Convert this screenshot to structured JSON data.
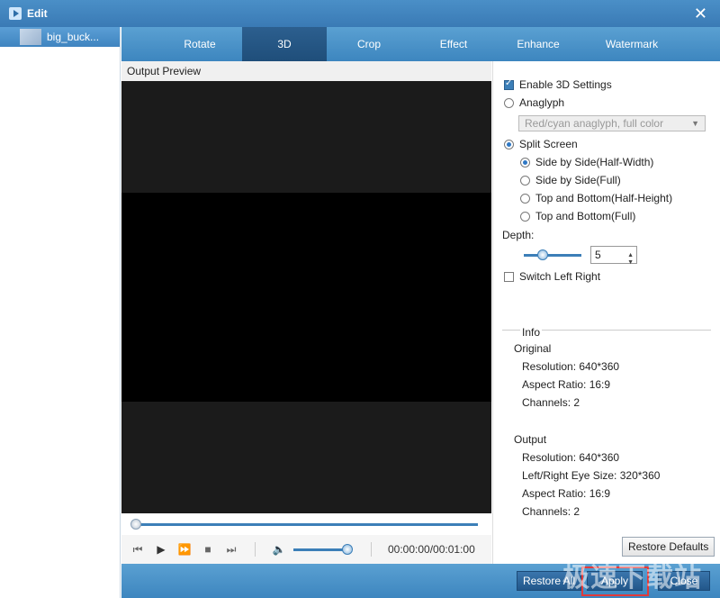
{
  "window": {
    "title": "Edit"
  },
  "sidebar": {
    "items": [
      {
        "label": "big_buck..."
      }
    ]
  },
  "tabs": [
    {
      "label": "Rotate"
    },
    {
      "label": "3D"
    },
    {
      "label": "Crop"
    },
    {
      "label": "Effect"
    },
    {
      "label": "Enhance"
    },
    {
      "label": "Watermark"
    }
  ],
  "active_tab": "3D",
  "preview": {
    "header": "Output Preview",
    "time": "00:00:00/00:01:00",
    "seek_position": 0.0,
    "volume_level": 1.0
  },
  "settings": {
    "enable_3d": {
      "label": "Enable 3D Settings",
      "checked": true
    },
    "anaglyph": {
      "label": "Anaglyph",
      "checked": false
    },
    "anaglyph_select": "Red/cyan anaglyph, full color",
    "split_screen": {
      "label": "Split Screen",
      "checked": true
    },
    "split_options": [
      {
        "label": "Side by Side(Half-Width)",
        "checked": true
      },
      {
        "label": "Side by Side(Full)",
        "checked": false
      },
      {
        "label": "Top and Bottom(Half-Height)",
        "checked": false
      },
      {
        "label": "Top and Bottom(Full)",
        "checked": false
      }
    ],
    "depth_label": "Depth:",
    "depth_value": "5",
    "switch_left_right": {
      "label": "Switch Left Right",
      "checked": false
    }
  },
  "info": {
    "legend": "Info",
    "original_title": "Original",
    "original": [
      "Resolution: 640*360",
      "Aspect Ratio: 16:9",
      "Channels: 2"
    ],
    "output_title": "Output",
    "output": [
      "Resolution: 640*360",
      "Left/Right Eye Size: 320*360",
      "Aspect Ratio: 16:9",
      "Channels: 2"
    ]
  },
  "buttons": {
    "restore_defaults": "Restore Defaults",
    "restore_all": "Restore All",
    "apply": "Apply",
    "close": "Close"
  },
  "watermark": "极速下载站",
  "colors": {
    "accent": "#3d86bf",
    "active_tab": "#1f4e7a",
    "highlight": "#e23a3a"
  }
}
